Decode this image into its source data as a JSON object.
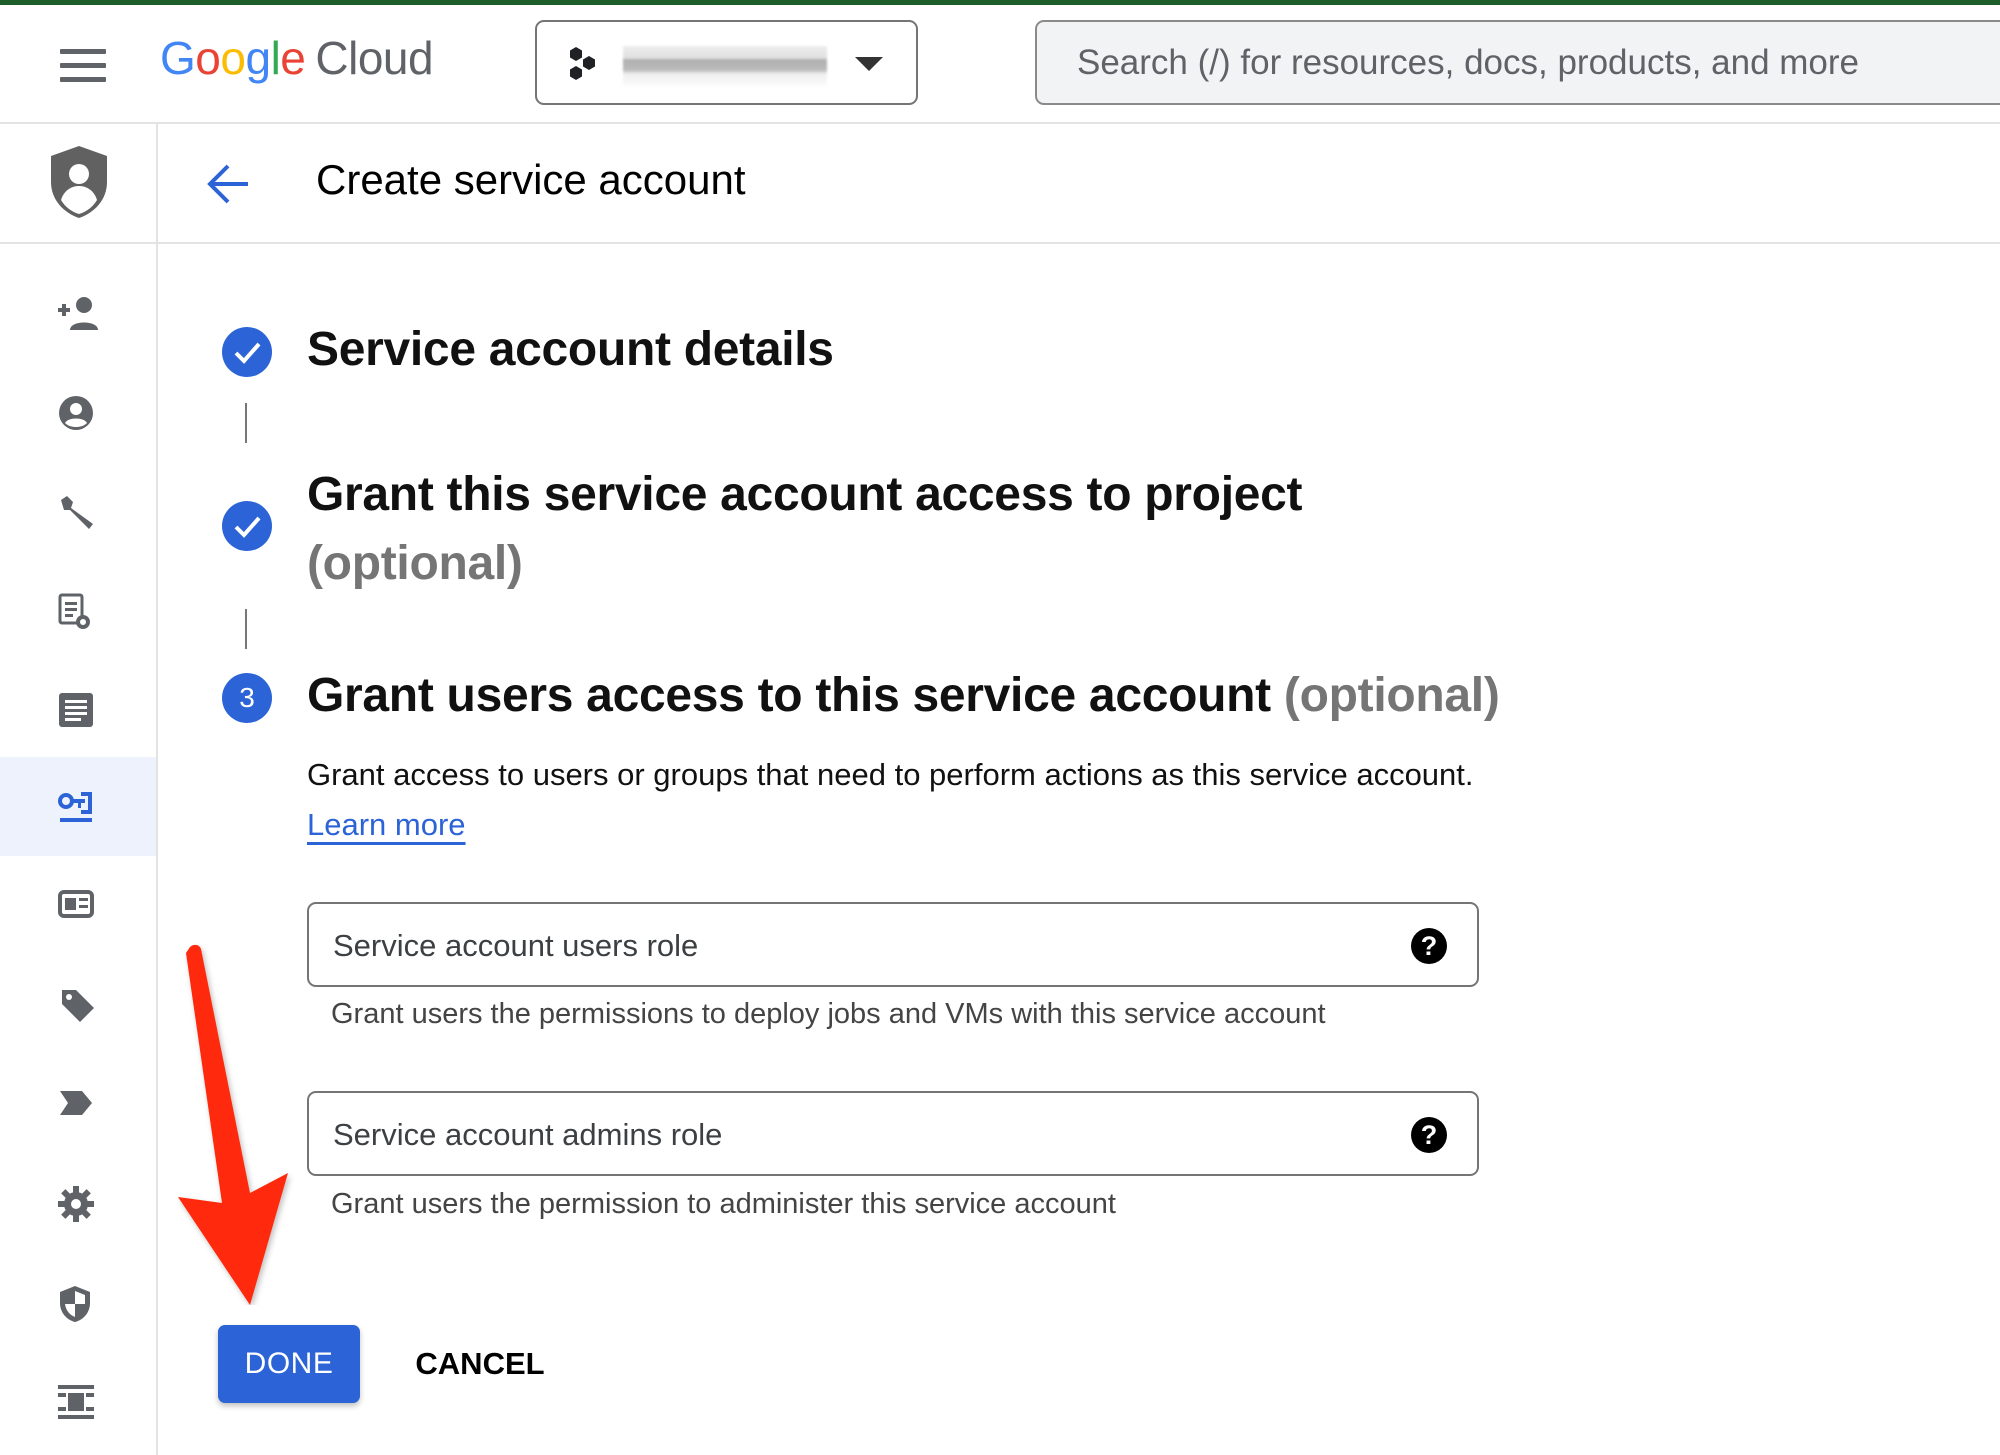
{
  "header": {
    "menu_icon": "hamburger-menu-icon",
    "logo": {
      "google": [
        "G",
        "o",
        "o",
        "g",
        "l",
        "e"
      ],
      "product": "Cloud"
    },
    "project_selector": {
      "icon": "project-hexagons-icon",
      "value_redacted": true,
      "caret_icon": "caret-down-icon"
    },
    "search": {
      "placeholder": "Search (/) for resources, docs, products, and more",
      "value": ""
    }
  },
  "sidebar": {
    "brand_icon": "iam-shield-person-icon",
    "items": [
      {
        "icon": "person-add-icon",
        "active": false
      },
      {
        "icon": "account-circle-icon",
        "active": false
      },
      {
        "icon": "wrench-icon",
        "active": false
      },
      {
        "icon": "policy-document-icon",
        "active": false
      },
      {
        "icon": "audit-log-icon",
        "active": false
      },
      {
        "icon": "service-account-key-icon",
        "active": true
      },
      {
        "icon": "identity-card-icon",
        "active": false
      },
      {
        "icon": "tag-icon",
        "active": false
      },
      {
        "icon": "label-arrow-icon",
        "active": false
      },
      {
        "icon": "settings-gear-icon",
        "active": false
      },
      {
        "icon": "security-shield-icon",
        "active": false
      },
      {
        "icon": "quotas-icon",
        "active": false
      }
    ]
  },
  "titlebar": {
    "back_icon": "arrow-back-icon",
    "title": "Create service account"
  },
  "steps": [
    {
      "status": "done",
      "title": "Service account details",
      "optional": ""
    },
    {
      "status": "done",
      "title": "Grant this service account access to project",
      "optional": "(optional)"
    },
    {
      "status": "current",
      "number": "3",
      "title": "Grant users access to this service account",
      "optional": "(optional)"
    }
  ],
  "step3": {
    "description": "Grant access to users or groups that need to perform actions as this service account.",
    "learn_more": "Learn more",
    "fields": [
      {
        "placeholder": "Service account users role",
        "value": "",
        "hint": "Grant users the permissions to deploy jobs and VMs with this service account"
      },
      {
        "placeholder": "Service account admins role",
        "value": "",
        "hint": "Grant users the permission to administer this service account"
      }
    ]
  },
  "actions": {
    "done": "DONE",
    "cancel": "CANCEL"
  },
  "colors": {
    "primary": "#2c63d6",
    "top_accent": "#1e5e2a",
    "annotation_arrow": "#ff2a0a",
    "active_nav_bg": "#edf2fd"
  },
  "annotation": {
    "type": "red-arrow",
    "points_to": "done-button"
  }
}
